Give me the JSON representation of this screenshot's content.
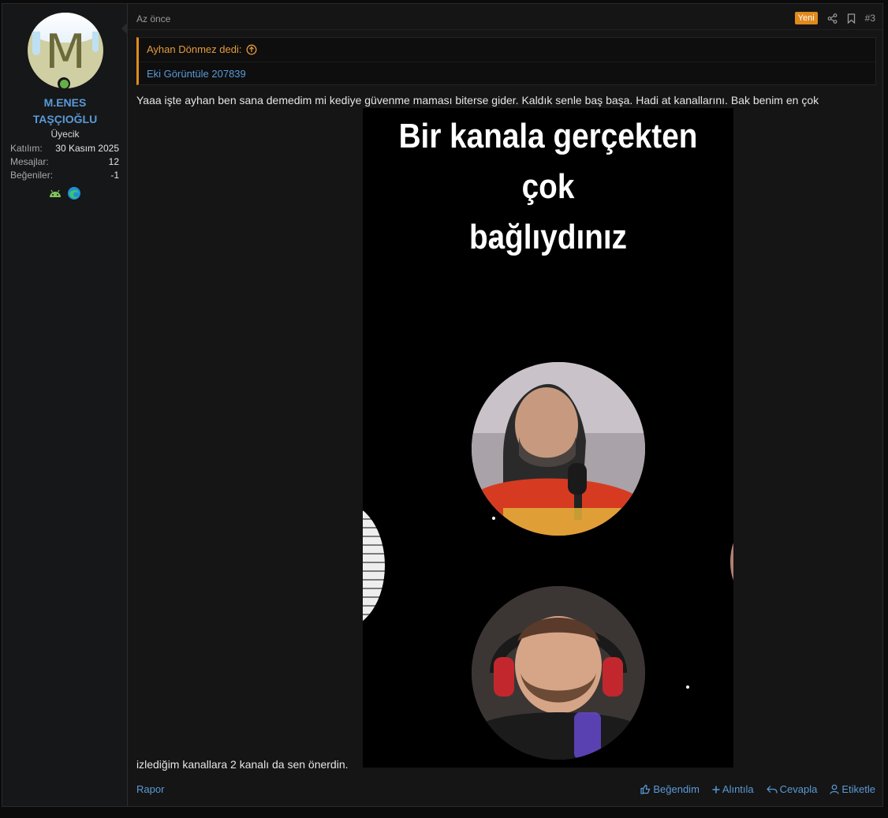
{
  "user": {
    "avatar_letter": "M",
    "name_line1": "M.ENES",
    "name_line2": "TAŞÇIOĞLU",
    "title": "Üyecik",
    "stats": [
      {
        "key": "Katılım:",
        "value": "30 Kasım 2025"
      },
      {
        "key": "Mesajlar:",
        "value": "12"
      },
      {
        "key": "Beğeniler:",
        "value": "-1"
      }
    ],
    "device_icons": [
      "android-icon",
      "edge-browser-icon"
    ]
  },
  "post": {
    "time": "Az önce",
    "new_badge": "Yeni",
    "number": "#3",
    "quote": {
      "author": "Ayhan Dönmez dedi:",
      "link": "Eki Görüntüle 207839"
    },
    "text_line1": "Yaaa işte ayhan ben sana demedim mi kediye güvenme maması biterse gider. Kaldık senle baş başa. Hadi at kanallarını. Bak benim en çok",
    "text_line2": "izlediğim kanallara 2 kanalı da sen önerdin.",
    "media_caption_line1": "Bir kanala gerçekten çok",
    "media_caption_line2": "bağlıydınız"
  },
  "footer": {
    "report": "Rapor",
    "like": "Beğendim",
    "quote": "Alıntıla",
    "reply": "Cevapla",
    "tag": "Etiketle"
  },
  "colors": {
    "accent": "#e08a1e",
    "link": "#5a9ad8",
    "online": "#63b04a"
  }
}
